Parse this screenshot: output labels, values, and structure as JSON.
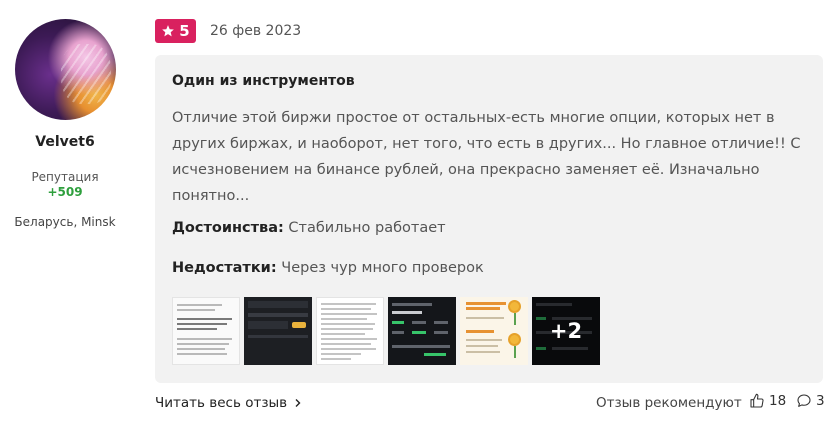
{
  "author": {
    "name": "Velvet6",
    "reputation_label": "Репутация",
    "reputation_value": "+509",
    "location": "Беларусь, Minsk"
  },
  "review": {
    "rating": "5",
    "date": "26 фев 2023",
    "title": "Один из инструментов",
    "body": "Отличие этой биржи простое от остальных-есть многие опции, которых нет в других биржах, и наоборот, нет того, что есть в других... Но главное отличие!! С исчезновением на бинансе рублей, она прекрасно заменяет её. Изначально понятно...",
    "pros_label": "Достоинства:",
    "pros_text": "Стабильно работает",
    "cons_label": "Недостатки:",
    "cons_text": "Через чур много проверок",
    "more_photos": "+2"
  },
  "footer": {
    "read_more": "Читать весь отзыв",
    "recommend": "Отзыв рекомендуют",
    "likes": "18",
    "comments": "3"
  },
  "colors": {
    "badge": "#d9215f",
    "reputation": "#2e9f3d",
    "card_bg": "#f2f2f2"
  },
  "icons": [
    "star-icon",
    "chevron-right-icon",
    "thumbs-up-icon",
    "comment-icon"
  ]
}
